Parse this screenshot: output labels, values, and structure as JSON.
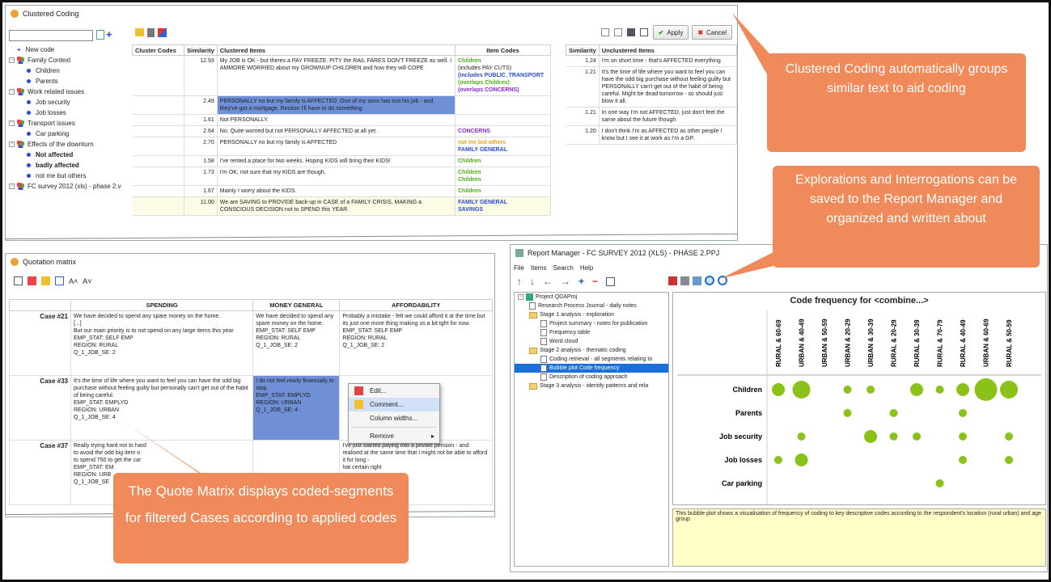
{
  "clustered": {
    "title": "Clustered Coding",
    "apply": "Apply",
    "cancel": "Cancel",
    "tree": [
      {
        "label": "New code",
        "kind": "add"
      },
      {
        "label": "Family Context",
        "kind": "group"
      },
      {
        "label": "Children",
        "kind": "leaf"
      },
      {
        "label": "Parents",
        "kind": "leaf"
      },
      {
        "label": "Work related issues",
        "kind": "group"
      },
      {
        "label": "Job security",
        "kind": "leaf"
      },
      {
        "label": "Job losses",
        "kind": "leaf"
      },
      {
        "label": "Transport issues",
        "kind": "group"
      },
      {
        "label": "Car parking",
        "kind": "leaf"
      },
      {
        "label": "Effects of the downturn",
        "kind": "group"
      },
      {
        "label": "Not affected",
        "kind": "leafbold"
      },
      {
        "label": "badly affected",
        "kind": "leafbold"
      },
      {
        "label": "not me but others",
        "kind": "leaf"
      },
      {
        "label": "FC survey 2012 (xls) - phase 2.v",
        "kind": "group2"
      }
    ],
    "cols": {
      "codes": "Cluster Codes",
      "sim": "Similarity",
      "items": "Clustered Items",
      "icodes": "Item Codes"
    },
    "rows": [
      {
        "sim": "12.93",
        "text": "My JOB is OK - but theres a PAY FREEZE. PITY the RAIL FARES DON'T FREEZE as well. I AMMORE WORRIED about my GROWNUP CHILDREN and how they will COPE",
        "c1": "Children",
        "c2": "(includes PAY CUTS)",
        "c3": "(includes PUBLIC_TRANSPORT",
        "c4": "(overlaps Children)",
        "c5": "(overlaps CONCERNS)"
      },
      {
        "sim": "2.49",
        "text": "PERSONALLY no but my family is AFFECTED. One of my sons has lost his job - and they've got a mortgage. Reckon I'll have to do something",
        "c1": ""
      },
      {
        "sim": "1.61",
        "text": "Not PERSONALLY.",
        "c1": ""
      },
      {
        "sim": "2.64",
        "text": "No. Quite worried but not PERSONALLY AFFECTED at all yet.",
        "c1": "CONCERNS"
      },
      {
        "sim": "2.70",
        "text": "PERSONALLY no but my family is AFFECTED",
        "c1": "not me but others",
        "c2": "FAMILY GENERAL"
      },
      {
        "sim": "1.58",
        "text": "I've rented a place for two weeks. Hoping KIDS will bring their KIDS!",
        "c1": "Children"
      },
      {
        "sim": "1.73",
        "text": "I'm OK, not sure that my KIDS are though.",
        "c1": "Children",
        "c2": "Children"
      },
      {
        "sim": "1.67",
        "text": "Mainly I worry about the KIDS.",
        "c1": "Children"
      },
      {
        "sim": "11.00",
        "text": "We are SAVING to PROVIDE back-up in CASE of a FAMILY CRISIS, MAKING a CONSCIOUS DECISION not to SPEND this YEAR.",
        "c1": "FAMILY GENERAL",
        "c2": "SAVINGS"
      }
    ],
    "ucols": {
      "sim": "Similarity",
      "items": "Unclustered Items"
    },
    "urows": [
      {
        "sim": "1.24",
        "text": "I'm on short time - that's AFFECTED everything"
      },
      {
        "sim": "1.21",
        "text": "It's the time of life where you want to feel you can have the odd big purchase without feeling guilty but PERSONALLY can't get out of the habit of being careful. Might be dead tomorrow - so should just blow it all."
      },
      {
        "sim": "1.21",
        "text": "In one way I'm not AFFECTED, just don't feel the same about the future though"
      },
      {
        "sim": "1.20",
        "text": "I don't think I'm as AFFECTED as other people I know but I see it at work as I'm a GP."
      }
    ]
  },
  "quotation": {
    "title": "Quotation matrix",
    "font_up": "A˄",
    "font_down": "A˅",
    "cols": [
      "SPENDING",
      "MONEY GENERAL",
      "AFFORDABILITY"
    ],
    "rows": [
      {
        "case": "Case #21",
        "a": "We have decided to spend any spare money on the home.\n[...]\nBut our main priority is to not spend on any large items this year\nEMP_STAT: SELF EMP\nREGION: RURAL\nQ_1_JOB_SE: 2",
        "b": "We have decided to spend any spare money on the home.\nEMP_STAT: SELF EMP\nREGION: RURAL\nQ_1_JOB_SE: 2",
        "c": "Probably a mistake - felt we could afford it at the time but its just one more thing making us a bit tght for now.\nEMP_STAT: SELF EMP\nREGION: RURAL\nQ_1_JOB_SE: 2"
      },
      {
        "case": "Case #33",
        "a": "It's the time of life where you want to feel you can have the odd big purchase without feeling guilty but personally can't get out of the habit of being careful.\nEMP_STAT: EMPLYD\nREGION: URBAN\nQ_1_JOB_SE: 4",
        "b": "I do not feel ready financially to stop.\nEMP_STAT: EMPLYD\nREGION: URBAN\nQ_1_JOB_SE: 4",
        "c": ""
      },
      {
        "case": "Case #37",
        "a": "Really trying hard not to hard\nto avoid the odd big item o\nto spend 750 to get the car\nEMP_STAT: EM\nREGION: URB\nQ_1_JOB_SE",
        "b": "",
        "c": "I've just started paying into a private pension - and realised at the same time that I might not be able to afford it for long -\nhat certain right"
      }
    ],
    "menu": [
      "Edit...",
      "Comment...",
      "Column widths...",
      "Remove"
    ]
  },
  "report": {
    "title": "Report Manager - FC SURVEY 2012 (XLS) - PHASE 2.PPJ",
    "menus": [
      "File",
      "Items",
      "Search",
      "Help"
    ],
    "tree": [
      {
        "label": "Project QDAProj",
        "indent": 0,
        "icon": "proj"
      },
      {
        "label": "Research Process Journal - daily notes",
        "indent": 1,
        "icon": "doc"
      },
      {
        "label": "Stage 1 analysis - exploration",
        "indent": 1,
        "icon": "folder"
      },
      {
        "label": "Project summary - notes for publication",
        "indent": 2,
        "icon": "doc"
      },
      {
        "label": "Frequency table",
        "indent": 2,
        "icon": "doc"
      },
      {
        "label": "Word cloud",
        "indent": 2,
        "icon": "doc"
      },
      {
        "label": "Stage 2 analysis - thematic coding",
        "indent": 1,
        "icon": "folder"
      },
      {
        "label": "Coding retrieval - all segments relating to",
        "indent": 2,
        "icon": "doc"
      },
      {
        "label": "Bubble plot Code frequency",
        "indent": 2,
        "icon": "doc",
        "sel": true
      },
      {
        "label": "Description of coding approach",
        "indent": 2,
        "icon": "doc"
      },
      {
        "label": "Stage 3 analysis - identify patterns and rela",
        "indent": 1,
        "icon": "folder"
      }
    ],
    "notes": "This bubble plot shows a visualisation of frequency of coding to key descriptive codes according to the respondent's location (rural urban) and age group"
  },
  "chart_data": {
    "type": "bubble",
    "title": "Code frequency for <combine...>",
    "columns": [
      "RURAL & 60-69",
      "URBAN & 40-49",
      "URBAN & 50-59",
      "URBAN & 20-29",
      "URBAN & 30-39",
      "RURAL & 20-29",
      "RURAL & 30-39",
      "RURAL & 70-79",
      "RURAL & 40-49",
      "URBAN & 60-69",
      "RURAL & 50-59"
    ],
    "rows": [
      "Children",
      "Parents",
      "Job security",
      "Job losses",
      "Car parking"
    ],
    "values": [
      [
        2,
        3,
        0,
        1,
        1,
        0,
        2,
        1,
        2,
        4,
        3
      ],
      [
        0,
        0,
        0,
        1,
        0,
        1,
        0,
        0,
        1,
        0,
        0
      ],
      [
        0,
        1,
        0,
        0,
        2,
        1,
        1,
        0,
        1,
        0,
        1
      ],
      [
        1,
        2,
        0,
        0,
        0,
        0,
        0,
        0,
        1,
        0,
        1
      ],
      [
        0,
        0,
        0,
        0,
        0,
        0,
        0,
        1,
        0,
        0,
        0
      ]
    ],
    "bubble_color": "#8bc21a"
  },
  "callouts": {
    "c1": "Clustered Coding automatically groups similar text to aid coding",
    "c2": "Explorations and Interrogations can be saved to the Report Manager and organized and written about",
    "c3": "The Quote Matrix displays coded-segments for filtered Cases according to applied codes"
  }
}
